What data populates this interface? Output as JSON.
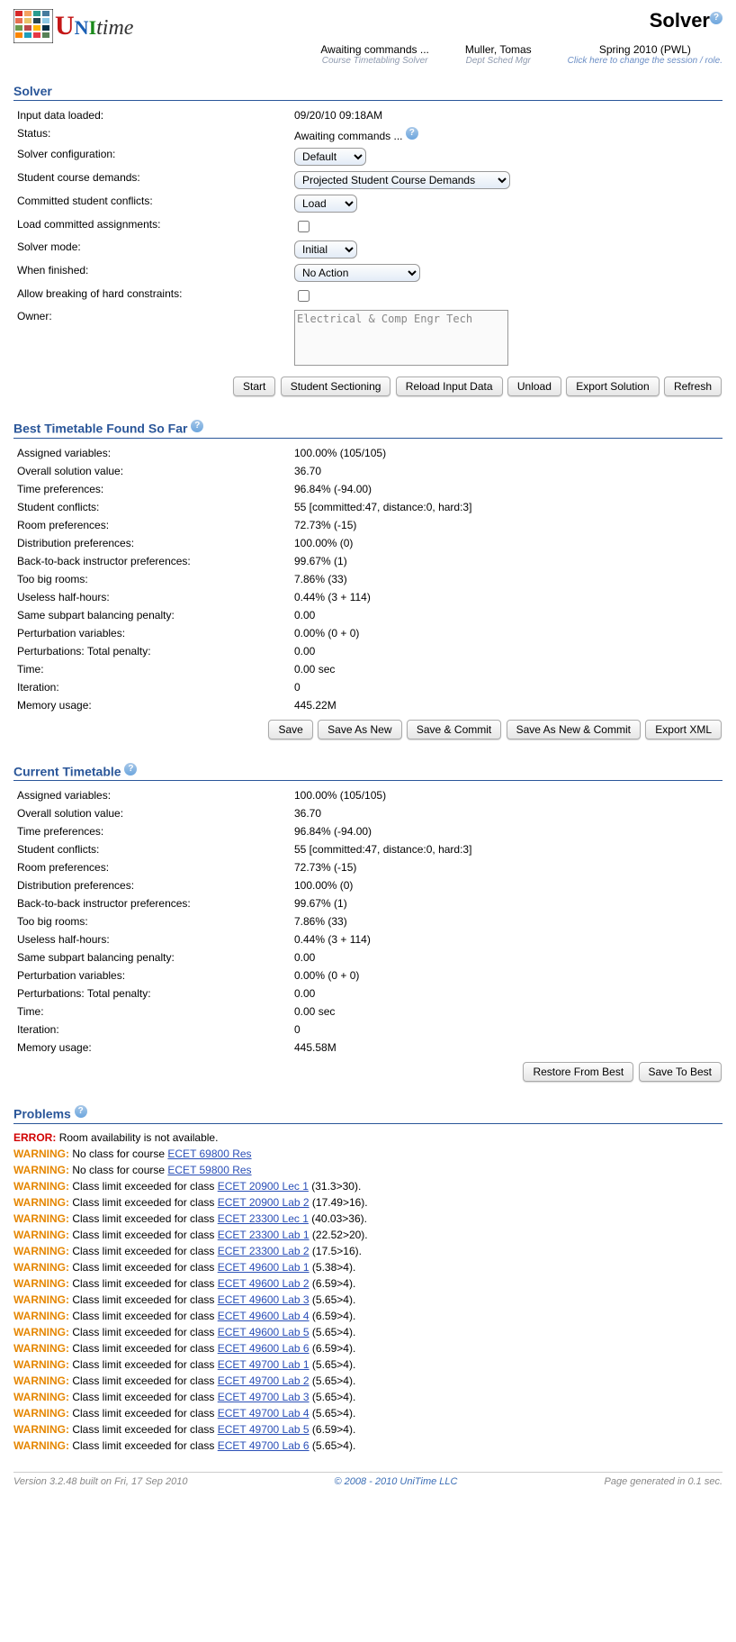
{
  "header": {
    "title": "Solver",
    "status": "Awaiting commands ...",
    "status_sub": "Course Timetabling Solver",
    "user": "Muller, Tomas",
    "user_sub": "Dept Sched Mgr",
    "session": "Spring 2010 (PWL)",
    "session_sub": "Click here to change the session / role."
  },
  "solver": {
    "title": "Solver",
    "fields": {
      "input_loaded_label": "Input data loaded:",
      "input_loaded_value": "09/20/10 09:18AM",
      "status_label": "Status:",
      "status_value": "Awaiting commands ...",
      "config_label": "Solver configuration:",
      "config_value": "Default",
      "demands_label": "Student course demands:",
      "demands_value": "Projected Student Course Demands",
      "committed_conflicts_label": "Committed student conflicts:",
      "committed_conflicts_value": "Load",
      "load_committed_label": "Load committed assignments:",
      "mode_label": "Solver mode:",
      "mode_value": "Initial",
      "finished_label": "When finished:",
      "finished_value": "No Action",
      "allow_break_label": "Allow breaking of hard constraints:",
      "owner_label": "Owner:",
      "owner_value": "Electrical & Comp Engr Tech"
    },
    "buttons": {
      "start": "Start",
      "sectioning": "Student Sectioning",
      "reload": "Reload Input Data",
      "unload": "Unload",
      "export": "Export Solution",
      "refresh": "Refresh"
    }
  },
  "best": {
    "title": "Best Timetable Found So Far",
    "rows": [
      {
        "label": "Assigned variables:",
        "value": "100.00% (105/105)"
      },
      {
        "label": "Overall solution value:",
        "value": "36.70"
      },
      {
        "label": "Time preferences:",
        "value": "96.84% (-94.00)"
      },
      {
        "label": "Student conflicts:",
        "value": "55 [committed:47, distance:0, hard:3]"
      },
      {
        "label": "Room preferences:",
        "value": "72.73% (-15)"
      },
      {
        "label": "Distribution preferences:",
        "value": "100.00% (0)"
      },
      {
        "label": "Back-to-back instructor preferences:",
        "value": "99.67% (1)"
      },
      {
        "label": "Too big rooms:",
        "value": "7.86% (33)"
      },
      {
        "label": "Useless half-hours:",
        "value": "0.44% (3 + 114)"
      },
      {
        "label": "Same subpart balancing penalty:",
        "value": "0.00"
      },
      {
        "label": "Perturbation variables:",
        "value": "0.00% (0 + 0)"
      },
      {
        "label": "Perturbations: Total penalty:",
        "value": "0.00"
      },
      {
        "label": "Time:",
        "value": "0.00 sec"
      },
      {
        "label": "Iteration:",
        "value": "0"
      },
      {
        "label": "Memory usage:",
        "value": "445.22M"
      }
    ],
    "buttons": {
      "save": "Save",
      "save_new": "Save As New",
      "save_commit": "Save & Commit",
      "save_new_commit": "Save As New & Commit",
      "export_xml": "Export XML"
    }
  },
  "current": {
    "title": "Current Timetable",
    "rows": [
      {
        "label": "Assigned variables:",
        "value": "100.00% (105/105)"
      },
      {
        "label": "Overall solution value:",
        "value": "36.70"
      },
      {
        "label": "Time preferences:",
        "value": "96.84% (-94.00)"
      },
      {
        "label": "Student conflicts:",
        "value": "55 [committed:47, distance:0, hard:3]"
      },
      {
        "label": "Room preferences:",
        "value": "72.73% (-15)"
      },
      {
        "label": "Distribution preferences:",
        "value": "100.00% (0)"
      },
      {
        "label": "Back-to-back instructor preferences:",
        "value": "99.67% (1)"
      },
      {
        "label": "Too big rooms:",
        "value": "7.86% (33)"
      },
      {
        "label": "Useless half-hours:",
        "value": "0.44% (3 + 114)"
      },
      {
        "label": "Same subpart balancing penalty:",
        "value": "0.00"
      },
      {
        "label": "Perturbation variables:",
        "value": "0.00% (0 + 0)"
      },
      {
        "label": "Perturbations: Total penalty:",
        "value": "0.00"
      },
      {
        "label": "Time:",
        "value": "0.00 sec"
      },
      {
        "label": "Iteration:",
        "value": "0"
      },
      {
        "label": "Memory usage:",
        "value": "445.58M"
      }
    ],
    "buttons": {
      "restore": "Restore From Best",
      "save_best": "Save To Best"
    }
  },
  "problems": {
    "title": "Problems",
    "error_label": "ERROR:",
    "error_text": "Room availability is not available.",
    "warning_label": "WARNING:",
    "items": [
      {
        "pre": "No class for course ",
        "link": "ECET 69800 Res",
        "post": ""
      },
      {
        "pre": "No class for course ",
        "link": "ECET 59800 Res",
        "post": ""
      },
      {
        "pre": "Class limit exceeded for class ",
        "link": "ECET 20900 Lec 1",
        "post": " (31.3>30)."
      },
      {
        "pre": "Class limit exceeded for class ",
        "link": "ECET 20900 Lab 2",
        "post": " (17.49>16)."
      },
      {
        "pre": "Class limit exceeded for class ",
        "link": "ECET 23300 Lec 1",
        "post": " (40.03>36)."
      },
      {
        "pre": "Class limit exceeded for class ",
        "link": "ECET 23300 Lab 1",
        "post": " (22.52>20)."
      },
      {
        "pre": "Class limit exceeded for class ",
        "link": "ECET 23300 Lab 2",
        "post": " (17.5>16)."
      },
      {
        "pre": "Class limit exceeded for class ",
        "link": "ECET 49600 Lab 1",
        "post": " (5.38>4)."
      },
      {
        "pre": "Class limit exceeded for class ",
        "link": "ECET 49600 Lab 2",
        "post": " (6.59>4)."
      },
      {
        "pre": "Class limit exceeded for class ",
        "link": "ECET 49600 Lab 3",
        "post": " (5.65>4)."
      },
      {
        "pre": "Class limit exceeded for class ",
        "link": "ECET 49600 Lab 4",
        "post": " (6.59>4)."
      },
      {
        "pre": "Class limit exceeded for class ",
        "link": "ECET 49600 Lab 5",
        "post": " (5.65>4)."
      },
      {
        "pre": "Class limit exceeded for class ",
        "link": "ECET 49600 Lab 6",
        "post": " (6.59>4)."
      },
      {
        "pre": "Class limit exceeded for class ",
        "link": "ECET 49700 Lab 1",
        "post": " (5.65>4)."
      },
      {
        "pre": "Class limit exceeded for class ",
        "link": "ECET 49700 Lab 2",
        "post": " (5.65>4)."
      },
      {
        "pre": "Class limit exceeded for class ",
        "link": "ECET 49700 Lab 3",
        "post": " (5.65>4)."
      },
      {
        "pre": "Class limit exceeded for class ",
        "link": "ECET 49700 Lab 4",
        "post": " (5.65>4)."
      },
      {
        "pre": "Class limit exceeded for class ",
        "link": "ECET 49700 Lab 5",
        "post": " (6.59>4)."
      },
      {
        "pre": "Class limit exceeded for class ",
        "link": "ECET 49700 Lab 6",
        "post": " (5.65>4)."
      }
    ]
  },
  "footer": {
    "version": "Version 3.2.48 built on Fri, 17 Sep 2010",
    "copyright": "© 2008 - 2010 UniTime LLC",
    "timing": "Page generated in 0.1 sec."
  }
}
